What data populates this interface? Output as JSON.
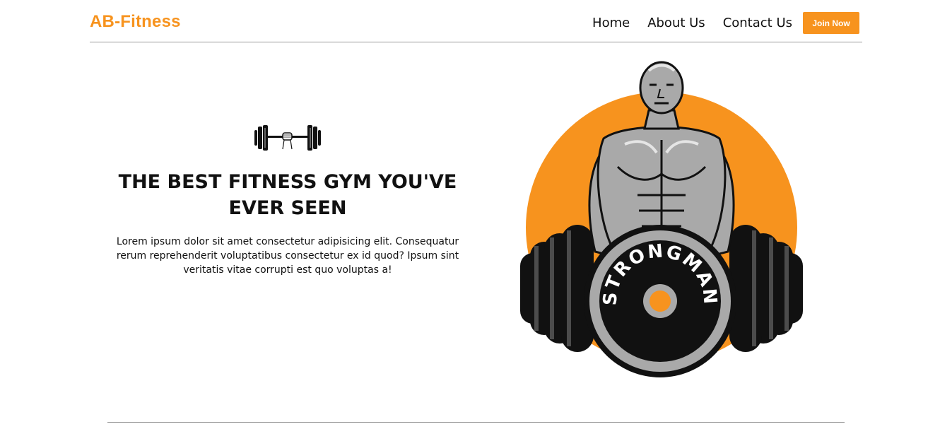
{
  "brand": {
    "name": "AB-Fitness",
    "accent_color": "#f7931e"
  },
  "nav": {
    "links": [
      "Home",
      "About Us",
      "Contact Us"
    ],
    "cta_label": "Join Now"
  },
  "hero": {
    "icon": "dumbbell-icon",
    "title": "THE BEST FITNESS GYM YOU'VE EVER SEEN",
    "text": "Lorem ipsum dolor sit amet consectetur adipisicing elit. Consequatur rerum reprehenderit voluptatibus consectetur ex id quod? Ipsum sint veritatis vitae corrupti est quo voluptas a!",
    "illustration": {
      "name": "strongman-bodybuilder-illustration",
      "plate_text": "STRONGMAN"
    }
  }
}
